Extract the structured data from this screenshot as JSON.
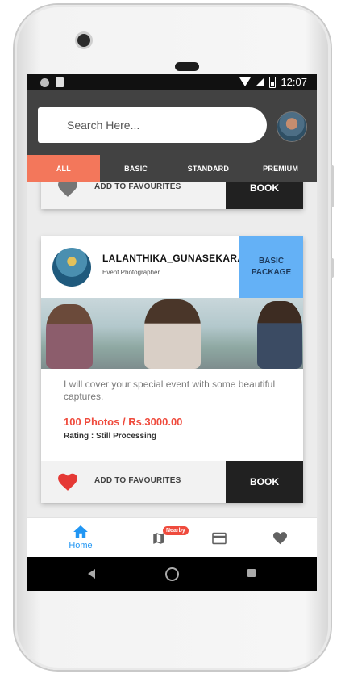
{
  "status_bar": {
    "time": "12:07"
  },
  "header": {
    "search": {
      "placeholder": "Search Here..."
    }
  },
  "tabs": [
    {
      "label": "ALL",
      "active": true
    },
    {
      "label": "BASIC",
      "active": false
    },
    {
      "label": "STANDARD",
      "active": false
    },
    {
      "label": "PREMIUM",
      "active": false
    }
  ],
  "colors": {
    "accent": "#f3775b",
    "header_bg": "#424242",
    "package_bg": "#64b1f6",
    "price": "#ef4b3d",
    "favourite_active": "#e53935",
    "favourite_inactive": "#757575",
    "nav_active": "#2196f3"
  },
  "cards": [
    {
      "favourite_label": "ADD TO FAVOURITES",
      "favourite_icon": "heart-icon",
      "favourited": false,
      "book_label": "BOOK"
    },
    {
      "name": "LALANTHIKA_GUNASEKARA",
      "role": "Event Photographer",
      "package_line1": "BASIC",
      "package_line2": "PACKAGE",
      "description": "I will cover your special event with some beautiful captures.",
      "price": "100 Photos / Rs.3000.00",
      "rating": "Rating : Still Processing",
      "favourite_label": "ADD TO FAVOURITES",
      "favourite_icon": "heart-icon",
      "favourited": true,
      "book_label": "BOOK"
    }
  ],
  "bottom_nav": [
    {
      "label": "Home",
      "icon": "home-icon",
      "active": true
    },
    {
      "label": "",
      "icon": "map-icon",
      "badge": "Nearby"
    },
    {
      "label": "",
      "icon": "card-icon"
    },
    {
      "label": "",
      "icon": "heart-icon"
    }
  ]
}
